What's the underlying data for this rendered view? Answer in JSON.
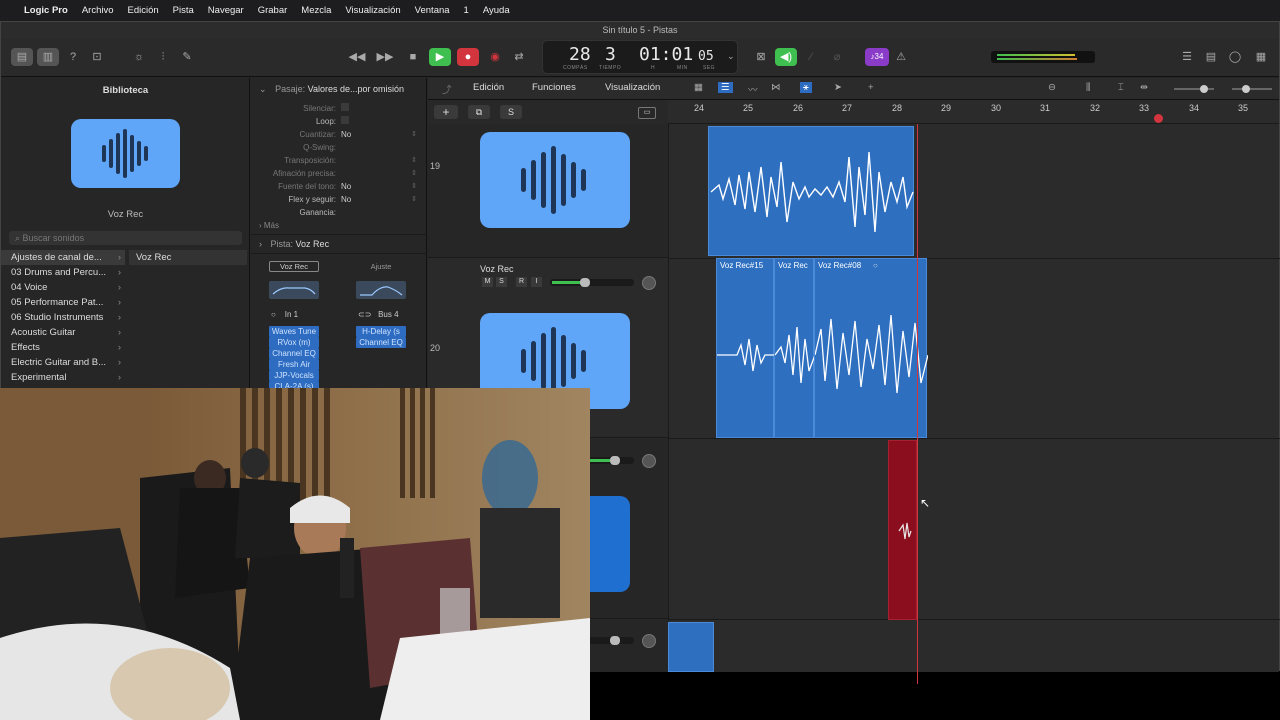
{
  "menubar": {
    "app": "Logic Pro",
    "items": [
      "Archivo",
      "Edición",
      "Pista",
      "Navegar",
      "Grabar",
      "Mezcla",
      "Visualización",
      "Ventana",
      "1",
      "Ayuda"
    ]
  },
  "window": {
    "title": "Sin título 5 - Pistas"
  },
  "lcd": {
    "bar": "28",
    "beat": "3",
    "bar_label": "COMPÁS",
    "beat_label": "TIEMPO",
    "time": "01:01",
    "time_frames": "05",
    "h_label": "H",
    "min_label": "MIN",
    "seg_label": "SEG"
  },
  "toolbar": {
    "key_badge": "♪34"
  },
  "library": {
    "title": "Biblioteca",
    "patch_name": "Voz Rec",
    "search_placeholder": "Buscar sonidos",
    "items": [
      "Ajustes de canal de...",
      "03 Drums and Percu...",
      "04 Voice",
      "05 Performance Pat...",
      "06 Studio Instruments",
      "Acoustic Guitar",
      "Effects",
      "Electric Guitar and B...",
      "Experimental"
    ],
    "selected_sub": "Voz Rec"
  },
  "inspector": {
    "section_title": "Pasaje:",
    "section_value": "Valores de...por omisión",
    "rows": [
      {
        "k": "Silenciar:",
        "v": ""
      },
      {
        "k": "Loop:",
        "v": ""
      },
      {
        "k": "Cuantizar:",
        "v": "No"
      },
      {
        "k": "Q-Swing:",
        "v": ""
      },
      {
        "k": "Transposición:",
        "v": ""
      },
      {
        "k": "Afinación precisa:",
        "v": ""
      },
      {
        "k": "Fuente del tono:",
        "v": "No"
      },
      {
        "k": "Flex y seguir:",
        "v": "No"
      },
      {
        "k": "Ganancia:",
        "v": ""
      }
    ],
    "more": "Más",
    "track_label": "Pista:",
    "track_value": "Voz Rec",
    "left_strip": {
      "setting": "Voz Rec",
      "input": "In 1",
      "plugins": [
        "Waves Tune",
        "RVox (m)",
        "Channel EQ",
        "Fresh Air",
        "JJP-Vocals",
        "CLA-2A (s)"
      ]
    },
    "right_strip": {
      "setting": "Ajuste",
      "input": "Bus 4",
      "plugins": [
        "H-Delay (s",
        "Channel EQ"
      ]
    }
  },
  "tracks": {
    "menus": [
      "Edición",
      "Funciones",
      "Visualización"
    ],
    "header_buttons": [
      "+",
      "S"
    ],
    "bars": [
      "24",
      "25",
      "26",
      "27",
      "28",
      "29",
      "30",
      "31",
      "32",
      "33",
      "34",
      "35"
    ],
    "rows": [
      {
        "number": "19",
        "name": ""
      },
      {
        "number": "20",
        "name": "Voz Rec",
        "buttons": [
          "M",
          "S",
          "R",
          "I"
        ]
      }
    ],
    "regions": [
      "Voz Rec#15",
      "Voz Rec",
      "Voz Rec#08"
    ]
  },
  "colors": {
    "accent_blue": "#5fa5f8",
    "region_blue": "#2e6fc0",
    "record_red": "#d3353e",
    "region_red": "#8b0e1e",
    "play_green": "#3fbf4f"
  }
}
